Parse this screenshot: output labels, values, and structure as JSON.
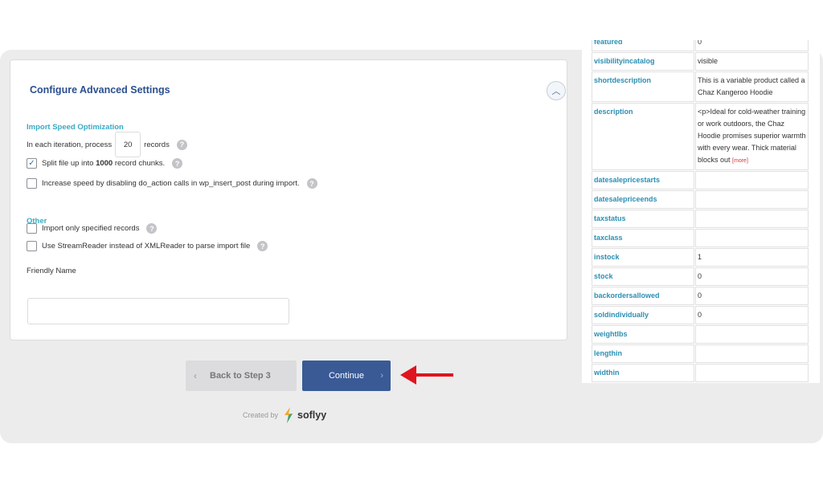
{
  "settings": {
    "title": "Configure Advanced Settings",
    "speed_heading": "Import Speed Optimization",
    "iteration_prefix": "In each iteration, process",
    "iteration_value": "20",
    "iteration_suffix": "records",
    "split_text_before": "Split file up into",
    "split_count": "1000",
    "split_text_after": "record chunks.",
    "split_checked": true,
    "disable_action_label": "Increase speed by disabling do_action calls in wp_insert_post during import.",
    "other_heading": "Other",
    "specified_records_label": "Import only specified records",
    "streamreader_label": "Use StreamReader instead of XMLReader to parse import file",
    "friendly_name_label": "Friendly Name",
    "friendly_name_value": ""
  },
  "buttons": {
    "back_label": "Back to Step 3",
    "continue_label": "Continue"
  },
  "credit": {
    "created_by": "Created by",
    "brand": "soflyy"
  },
  "record_table": {
    "rows": [
      {
        "key": "featured",
        "value": "0"
      },
      {
        "key": "visibilityincatalog",
        "value": "visible"
      },
      {
        "key": "shortdescription",
        "value": "This is a variable product called a Chaz Kangeroo Hoodie"
      },
      {
        "key": "description",
        "value": "<p>Ideal for cold-weather training or work outdoors, the Chaz Hoodie promises superior warmth with every wear. Thick material blocks out",
        "more": "[more]"
      },
      {
        "key": "datesalepricestarts",
        "value": ""
      },
      {
        "key": "datesalepriceends",
        "value": ""
      },
      {
        "key": "taxstatus",
        "value": ""
      },
      {
        "key": "taxclass",
        "value": ""
      },
      {
        "key": "instock",
        "value": "1"
      },
      {
        "key": "stock",
        "value": "0"
      },
      {
        "key": "backordersallowed",
        "value": "0"
      },
      {
        "key": "soldindividually",
        "value": "0"
      },
      {
        "key": "weightlbs",
        "value": ""
      },
      {
        "key": "lengthin",
        "value": ""
      },
      {
        "key": "widthin",
        "value": ""
      }
    ]
  },
  "icons": {
    "collapse": "chevron-up-icon",
    "help": "question-icon",
    "back_chevron": "chevron-left-icon",
    "continue_chevron": "chevron-right-icon",
    "annotation": "red-arrow-icon"
  },
  "colors": {
    "accent": "#3a5a96",
    "section_heading": "#3aa9c4",
    "table_key": "#2c8fb3",
    "arrow": "#e0141e"
  }
}
